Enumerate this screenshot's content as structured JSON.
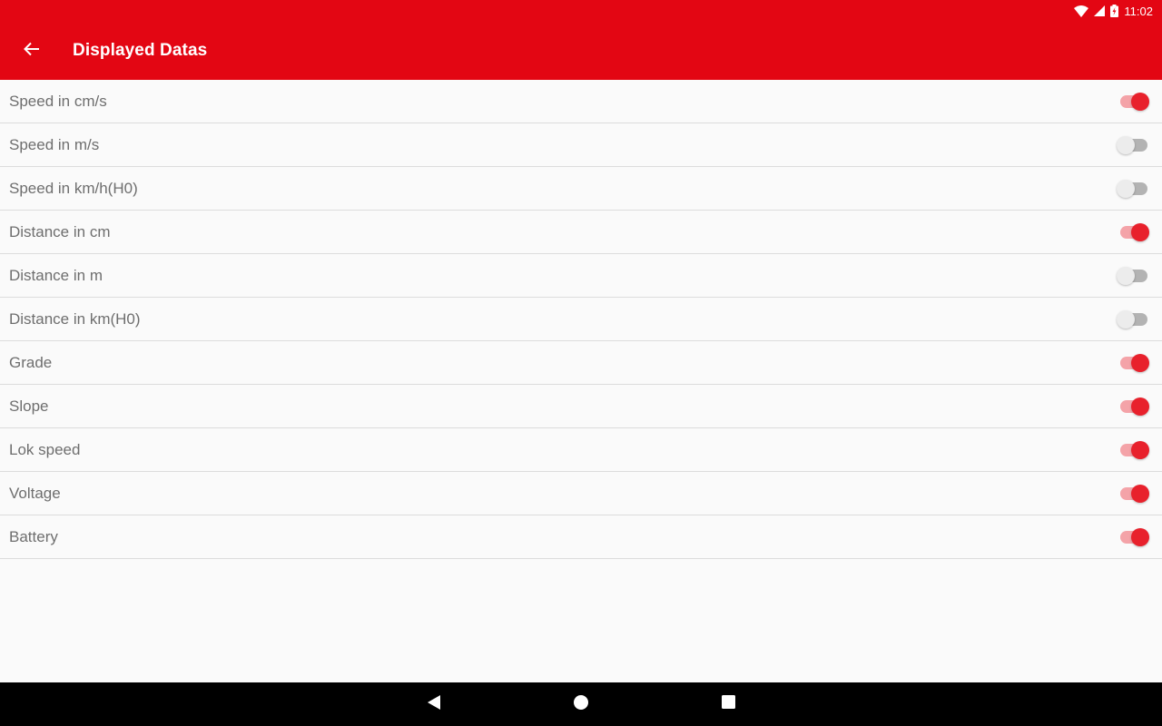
{
  "status_bar": {
    "time": "11:02",
    "icons": [
      "wifi-icon",
      "cell-signal-icon",
      "battery-charging-icon"
    ]
  },
  "toolbar": {
    "back_icon": "arrow-left-icon",
    "title": "Displayed Datas"
  },
  "settings": [
    {
      "label": "Speed in cm/s",
      "checked": true
    },
    {
      "label": "Speed in m/s",
      "checked": false
    },
    {
      "label": "Speed in km/h(H0)",
      "checked": false
    },
    {
      "label": "Distance in cm",
      "checked": true
    },
    {
      "label": "Distance in m",
      "checked": false
    },
    {
      "label": "Distance in km(H0)",
      "checked": false
    },
    {
      "label": "Grade",
      "checked": true
    },
    {
      "label": "Slope",
      "checked": true
    },
    {
      "label": "Lok speed",
      "checked": true
    },
    {
      "label": "Voltage",
      "checked": true
    },
    {
      "label": "Battery",
      "checked": true
    }
  ],
  "nav_bar": {
    "buttons": [
      "back-triangle-icon",
      "home-circle-icon",
      "recents-square-icon"
    ]
  },
  "colors": {
    "accent": "#e30613",
    "switch_on": "#e8212c",
    "switch_track_on": "#f4a3a8",
    "switch_off": "#ececec",
    "text": "#6e6e6e"
  }
}
